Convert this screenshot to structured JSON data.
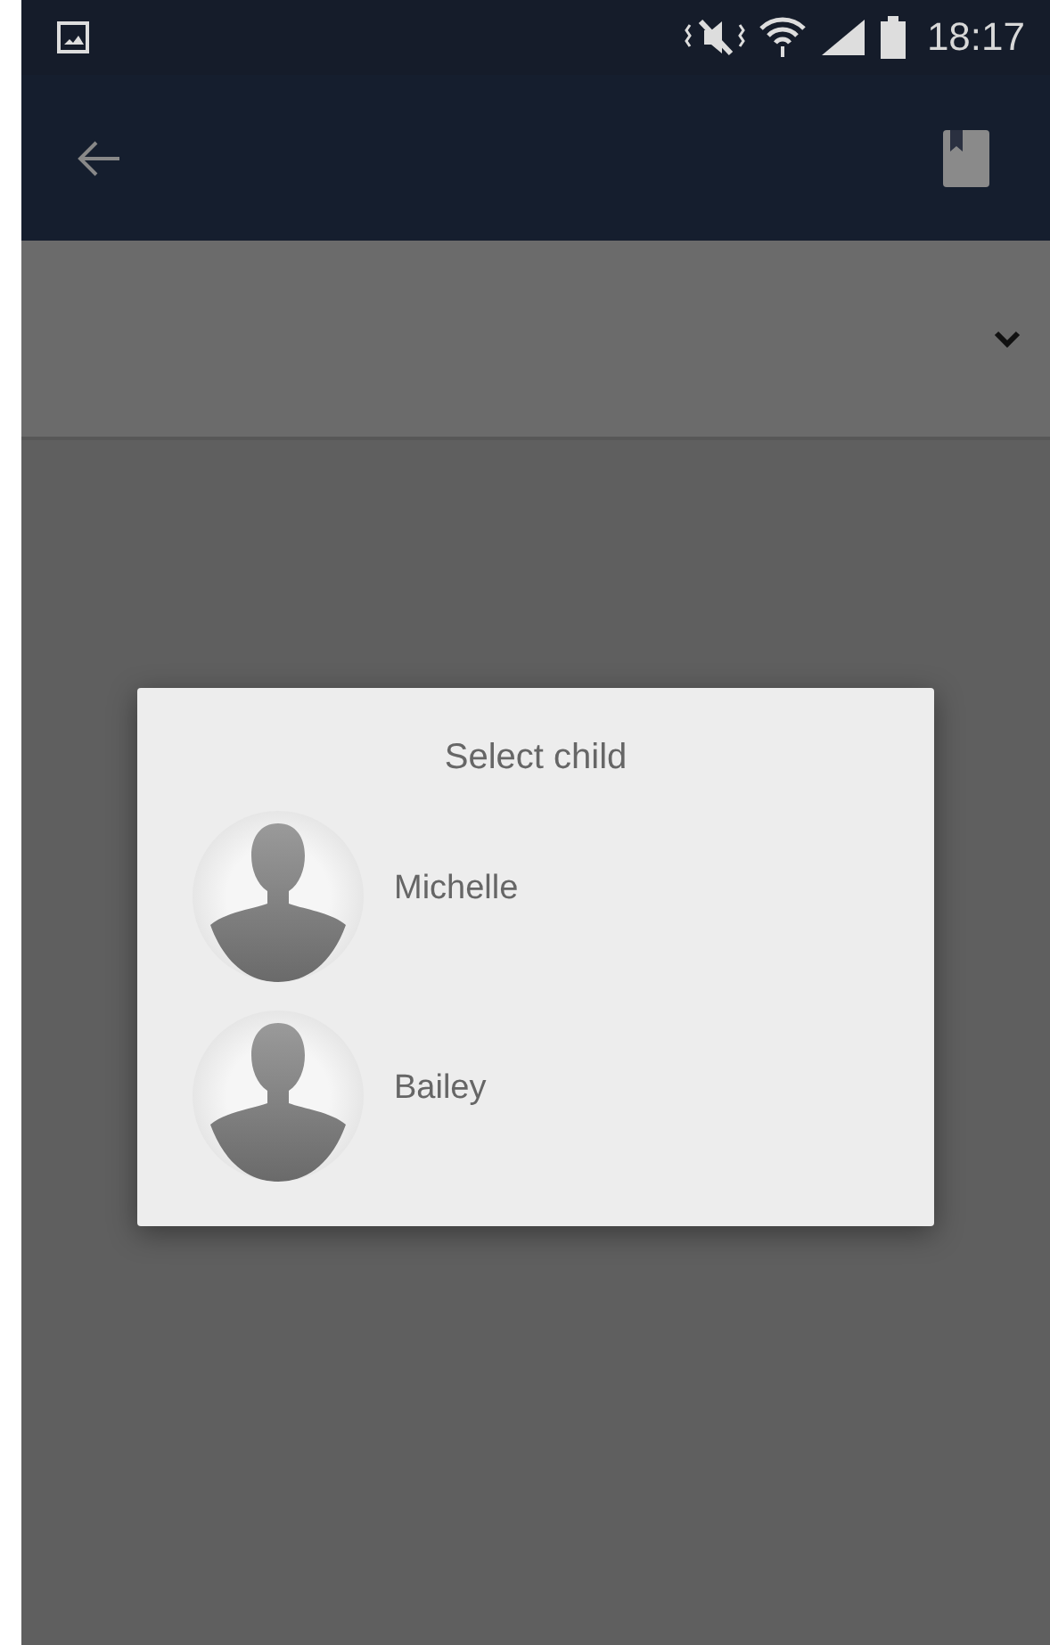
{
  "status_bar": {
    "time": "18:17"
  },
  "dialog": {
    "title": "Select child",
    "items": [
      {
        "name": "Michelle"
      },
      {
        "name": "Bailey"
      }
    ]
  }
}
